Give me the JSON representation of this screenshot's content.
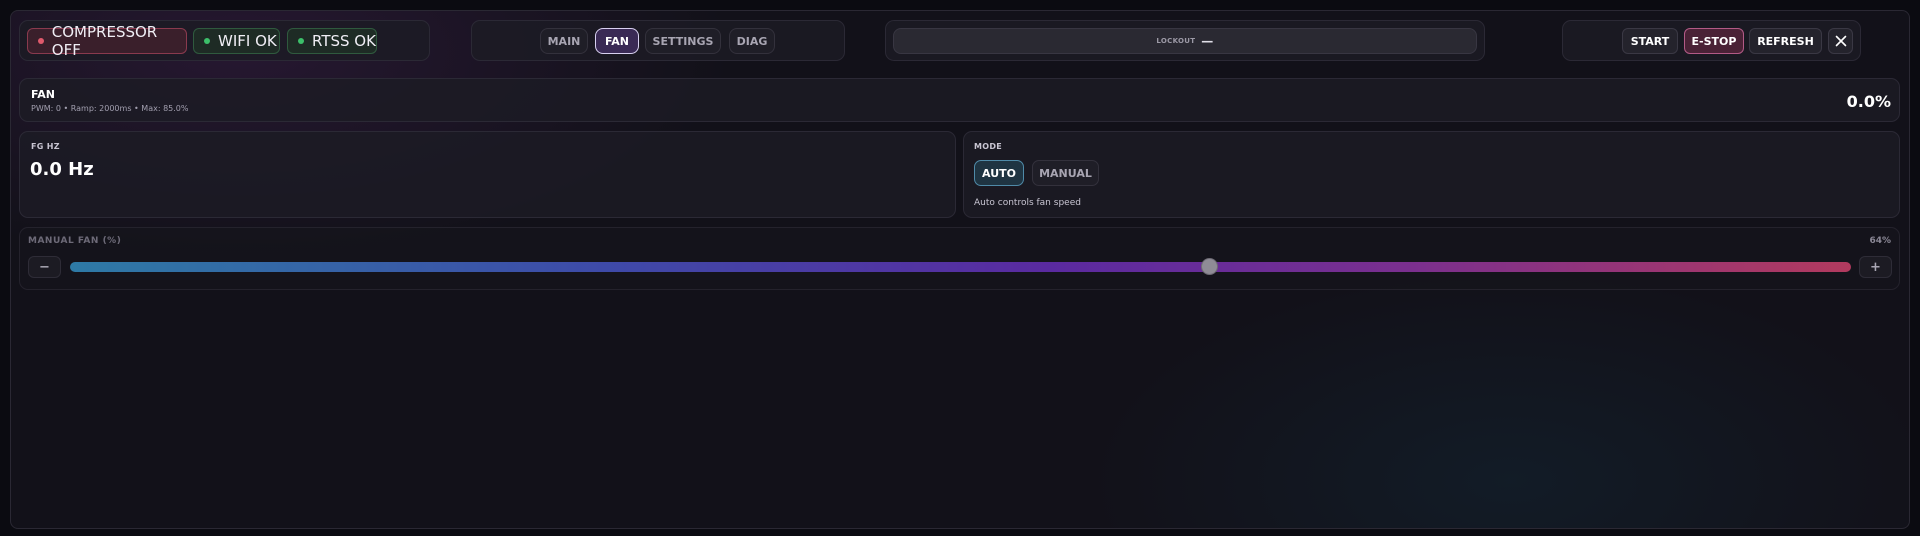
{
  "status": {
    "compressor": {
      "label": "COMPRESSOR OFF",
      "color": "#e05a6c"
    },
    "wifi": {
      "label": "WIFI OK",
      "color": "#3cc06a"
    },
    "rtss": {
      "label": "RTSS OK",
      "color": "#3cc06a"
    }
  },
  "tabs": [
    {
      "label": "MAIN",
      "active": false
    },
    {
      "label": "FAN",
      "active": true
    },
    {
      "label": "SETTINGS",
      "active": false
    },
    {
      "label": "DIAG",
      "active": false
    }
  ],
  "lockout": {
    "label": "LOCKOUT",
    "value": "—"
  },
  "actions": {
    "start": "START",
    "estop": "E-STOP",
    "refresh": "REFRESH",
    "close_icon": "close-icon"
  },
  "fan": {
    "title": "FAN",
    "subtitle": "PWM: 0 • Ramp: 2000ms • Max: 85.0%",
    "percent": "0.0%"
  },
  "fg": {
    "label": "FG HZ",
    "value": "0.0 Hz"
  },
  "mode": {
    "label": "MODE",
    "options": [
      {
        "label": "AUTO",
        "active": true
      },
      {
        "label": "MANUAL",
        "active": false
      }
    ],
    "hint": "Auto controls fan speed"
  },
  "manual_fan": {
    "label": "MANUAL FAN (%)",
    "value_text": "64%",
    "value": 64,
    "minus": "−",
    "plus": "+"
  },
  "colors": {
    "accent": "#5a2aa0",
    "estop": "#b35a86",
    "active_tab": "#d8d0f0"
  }
}
